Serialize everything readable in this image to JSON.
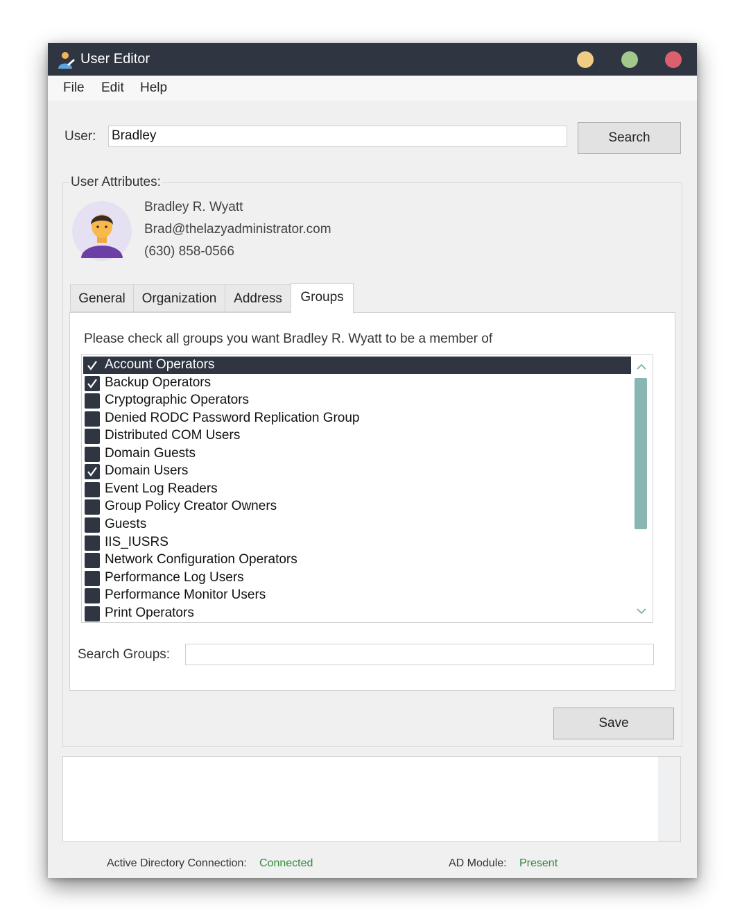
{
  "window": {
    "title": "User Editor"
  },
  "menu": {
    "file": "File",
    "edit": "Edit",
    "help": "Help"
  },
  "user_search": {
    "label": "User:",
    "value": "Bradley",
    "button": "Search"
  },
  "attributes": {
    "title": "User Attributes:",
    "name": "Bradley R. Wyatt",
    "email": "Brad@thelazyadministrator.com",
    "phone": "(630) 858-0566"
  },
  "tabs": [
    {
      "label": "General",
      "active": false
    },
    {
      "label": "Organization",
      "active": false
    },
    {
      "label": "Address",
      "active": false
    },
    {
      "label": "Groups",
      "active": true
    }
  ],
  "groups_panel": {
    "instruction": "Please check all groups you want Bradley R. Wyatt to be a member of",
    "items": [
      {
        "label": "Account Operators",
        "checked": true,
        "selected": true
      },
      {
        "label": "Backup Operators",
        "checked": true,
        "selected": false
      },
      {
        "label": "Cryptographic Operators",
        "checked": false,
        "selected": false
      },
      {
        "label": "Denied RODC Password Replication Group",
        "checked": false,
        "selected": false
      },
      {
        "label": "Distributed COM Users",
        "checked": false,
        "selected": false
      },
      {
        "label": "Domain Guests",
        "checked": false,
        "selected": false
      },
      {
        "label": "Domain Users",
        "checked": true,
        "selected": false
      },
      {
        "label": "Event Log Readers",
        "checked": false,
        "selected": false
      },
      {
        "label": "Group Policy Creator Owners",
        "checked": false,
        "selected": false
      },
      {
        "label": "Guests",
        "checked": false,
        "selected": false
      },
      {
        "label": "IIS_IUSRS",
        "checked": false,
        "selected": false
      },
      {
        "label": "Network Configuration Operators",
        "checked": false,
        "selected": false
      },
      {
        "label": "Performance Log Users",
        "checked": false,
        "selected": false
      },
      {
        "label": "Performance Monitor Users",
        "checked": false,
        "selected": false
      },
      {
        "label": "Print Operators",
        "checked": false,
        "selected": false
      }
    ],
    "search_label": "Search Groups:",
    "search_value": ""
  },
  "save_button": "Save",
  "log_output": "",
  "status": {
    "ad_connection_label": "Active Directory Connection:",
    "ad_connection_value": "Connected",
    "ad_module_label": "AD Module:",
    "ad_module_value": "Present"
  },
  "colors": {
    "titlebar": "#2f3541",
    "minimize": "#f0cc84",
    "maximize": "#a2c88b",
    "close": "#d9606c",
    "status_ok": "#2e8b3a",
    "scroll_thumb": "#88b7b3"
  },
  "icons": [
    "user-editor-app-icon",
    "user-avatar-icon",
    "checkmark-icon",
    "chevron-up-icon",
    "chevron-down-icon"
  ]
}
